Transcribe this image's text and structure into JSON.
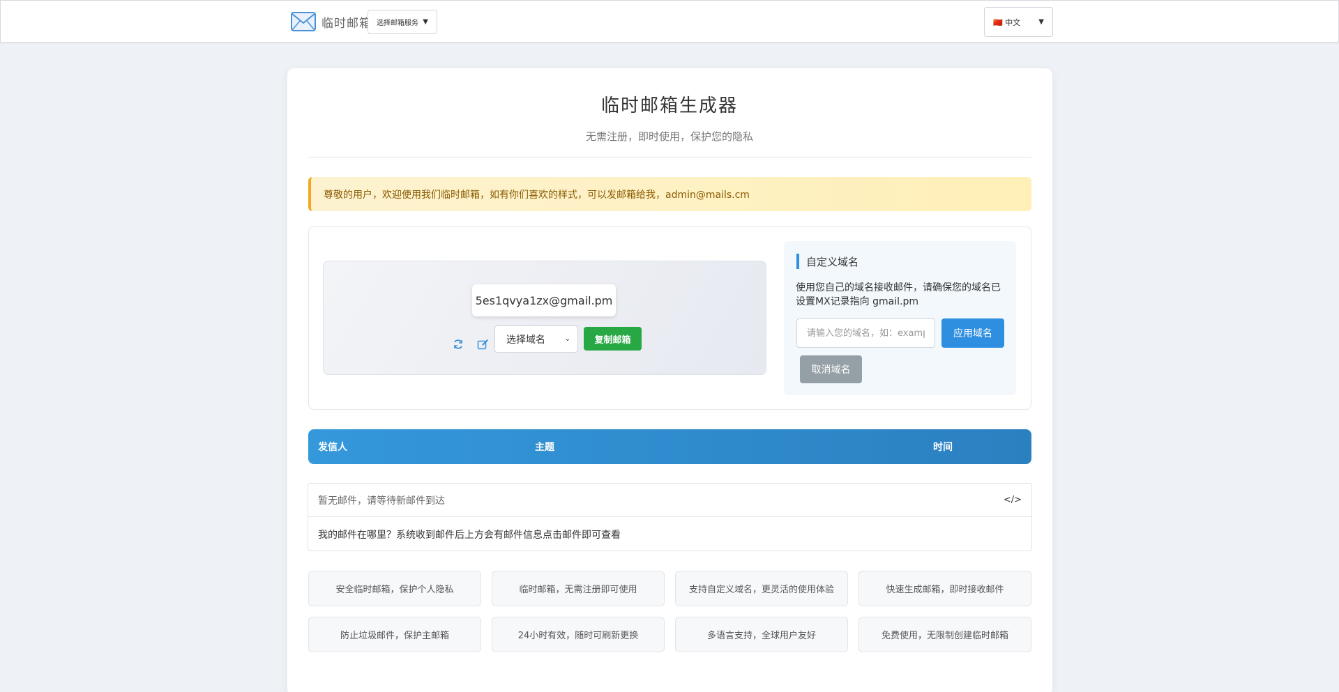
{
  "header": {
    "logo_text": "临时邮箱",
    "nav_select_value": "选择邮箱服务",
    "lang_flag": "🇨🇳",
    "lang_value": "中文"
  },
  "main": {
    "title": "临时邮箱生成器",
    "subtitle": "无需注册，即时使用，保护您的隐私",
    "notice": "尊敬的用户，欢迎使用我们临时邮箱，如有你们喜欢的样式，可以发邮箱给我，admin@mails.cm"
  },
  "generator": {
    "email": "5es1qvya1zx@gmail.pm",
    "domain_select": "选择域名",
    "copy_label": "复制邮箱"
  },
  "custom_domain": {
    "title": "自定义域名",
    "description": "使用您自己的域名接收邮件，请确保您的域名已设置MX记录指向 gmail.pm",
    "input_placeholder": "请输入您的域名，如：example.com",
    "apply_label": "应用域名",
    "cancel_label": "取消域名"
  },
  "table": {
    "columns": [
      "发信人",
      "主题",
      "时间"
    ]
  },
  "info": {
    "header": "暂无邮件，请等待新邮件到达",
    "body": "我的邮件在哪里？系统收到邮件后上方会有邮件信息点击邮件即可查看"
  },
  "features": [
    "安全临时邮箱，保护个人隐私",
    "临时邮箱，无需注册即可使用",
    "支持自定义域名，更灵活的使用体验",
    "快速生成邮箱，即时接收邮件",
    "防止垃圾邮件，保护主邮箱",
    "24小时有效，随时可刷新更换",
    "多语言支持，全球用户友好",
    "免费使用，无限制创建临时邮箱"
  ],
  "colors": {
    "primary": "#3498db",
    "success": "#28a745",
    "notice_border": "#f2a922",
    "secondary": "#95a0a6"
  },
  "icons": {
    "logo": "envelope-icon",
    "refresh": "refresh-icon",
    "edit": "edit-icon",
    "code": "code-icon"
  }
}
